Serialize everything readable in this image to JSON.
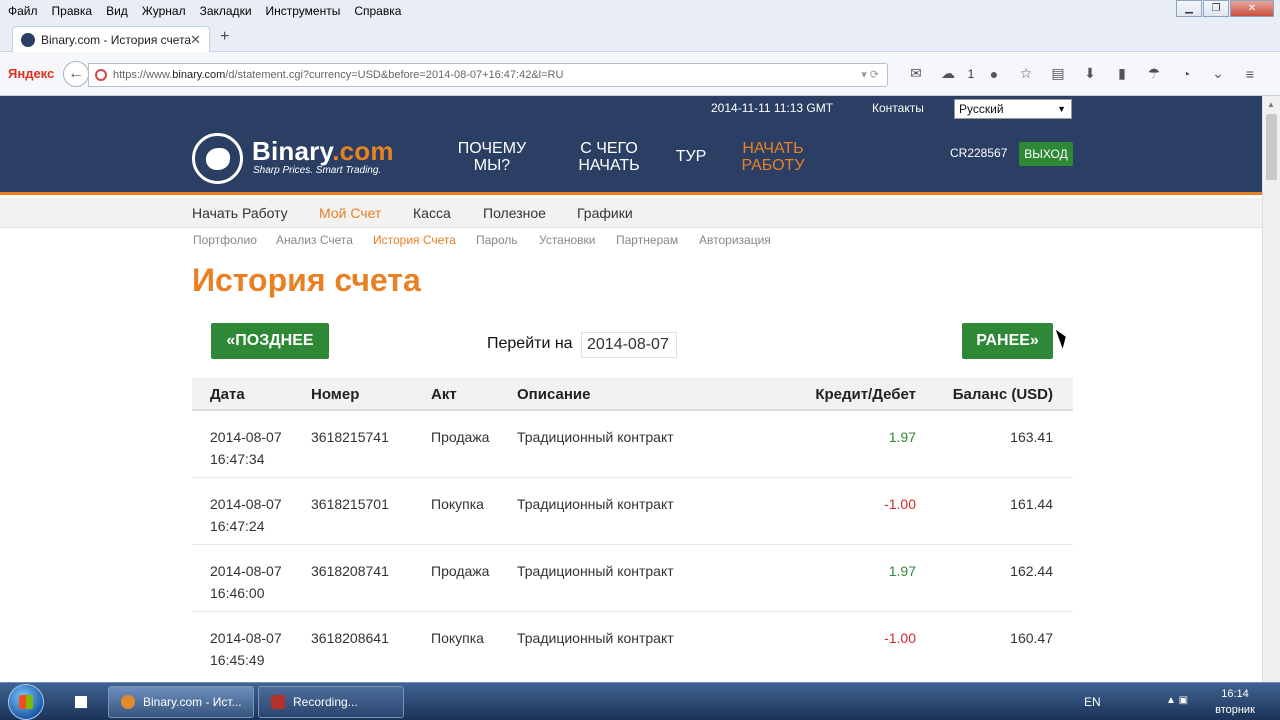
{
  "browser": {
    "menu": [
      "Файл",
      "Правка",
      "Вид",
      "Журнал",
      "Закладки",
      "Инструменты",
      "Справка"
    ],
    "tab_title": "Binary.com - История счета",
    "search_brand": "Яндекс",
    "url_prefix": "https://www.",
    "url_domain": "binary.com",
    "url_path": "/d/statement.cgi?currency=USD&before=2014-08-07+16:47:42&l=RU",
    "badge_count": "1"
  },
  "site": {
    "datetime": "2014-11-11 11:13 GMT",
    "contacts": "Контакты",
    "language": "Русский",
    "logo_main": "Binary",
    "logo_dot": ".com",
    "logo_tagline": "Sharp Prices. Smart Trading.",
    "nav": {
      "why": [
        "ПОЧЕМУ",
        "МЫ?"
      ],
      "start": [
        "С ЧЕГО",
        "НАЧАТЬ"
      ],
      "tour": "ТУР",
      "begin": [
        "НАЧАТЬ",
        "РАБОТУ"
      ]
    },
    "account_id": "CR228567",
    "logout": "ВЫХОД",
    "menu": [
      "Начать Работу",
      "Мой Счет",
      "Касса",
      "Полезное",
      "Графики"
    ],
    "submenu": [
      "Портфолио",
      "Анализ Счета",
      "История Счета",
      "Пароль",
      "Установки",
      "Партнерам",
      "Авторизация"
    ]
  },
  "statement": {
    "title": "История счета",
    "later_btn": "«ПОЗДНЕЕ",
    "earlier_btn": "РАНЕЕ»",
    "goto_label": "Перейти на",
    "goto_value": "2014-08-07",
    "headers": [
      "Дата",
      "Номер",
      "Акт",
      "Описание",
      "Кредит/Дебет",
      "Баланс (USD)"
    ],
    "rows": [
      {
        "date": "2014-08-07",
        "time": "16:47:34",
        "ref": "3618215741",
        "act": "Продажа",
        "desc": "Традиционный контракт",
        "amount": "1.97",
        "balance": "163.41"
      },
      {
        "date": "2014-08-07",
        "time": "16:47:24",
        "ref": "3618215701",
        "act": "Покупка",
        "desc": "Традиционный контракт",
        "amount": "-1.00",
        "balance": "161.44"
      },
      {
        "date": "2014-08-07",
        "time": "16:46:00",
        "ref": "3618208741",
        "act": "Продажа",
        "desc": "Традиционный контракт",
        "amount": "1.97",
        "balance": "162.44"
      },
      {
        "date": "2014-08-07",
        "time": "16:45:49",
        "ref": "3618208641",
        "act": "Покупка",
        "desc": "Традиционный контракт",
        "amount": "-1.00",
        "balance": "160.47"
      }
    ]
  },
  "taskbar": {
    "task1": "Binary.com - Ист...",
    "task2": "Recording...",
    "lang": "EN",
    "time": "16:14",
    "day": "вторник"
  },
  "colors": {
    "brand_navy": "#2a3f63",
    "brand_orange": "#e98024",
    "button_green": "#2e8836",
    "credit_green": "#2e8836",
    "debit_red": "#d02b2b"
  }
}
